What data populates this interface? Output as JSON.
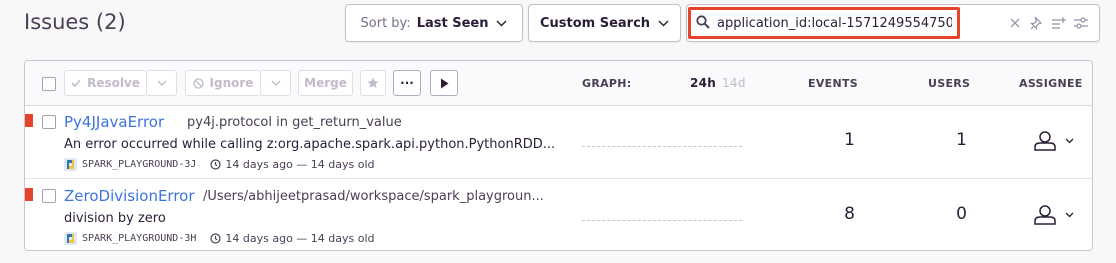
{
  "page": {
    "title": "Issues (2)"
  },
  "toolbar": {
    "sort_label": "Sort by:",
    "sort_value": "Last Seen",
    "custom_search": "Custom Search",
    "search_value": "application_id:local-1571249554750"
  },
  "actions": {
    "resolve": "Resolve",
    "ignore": "Ignore",
    "merge": "Merge",
    "more": "..."
  },
  "columns": {
    "graph": "GRAPH:",
    "range_24h": "24h",
    "range_14d": "14d",
    "events": "EVENTS",
    "users": "USERS",
    "assignee": "ASSIGNEE"
  },
  "issues": [
    {
      "title": "Py4JJavaError",
      "location": "py4j.protocol in get_return_value",
      "message": "An error occurred while calling z:org.apache.spark.api.python.PythonRDD...",
      "project": "SPARK_PLAYGROUND-3J",
      "time": "14 days ago — 14 days old",
      "events": "1",
      "users": "1"
    },
    {
      "title": "ZeroDivisionError",
      "location": "/Users/abhijeetprasad/workspace/spark_playgroun...",
      "message": "division by zero",
      "project": "SPARK_PLAYGROUND-3H",
      "time": "14 days ago — 14 days old",
      "events": "8",
      "users": "0"
    }
  ],
  "colors": {
    "accent": "#3d74db",
    "error": "#e3442b",
    "highlight": "#e3442b"
  }
}
